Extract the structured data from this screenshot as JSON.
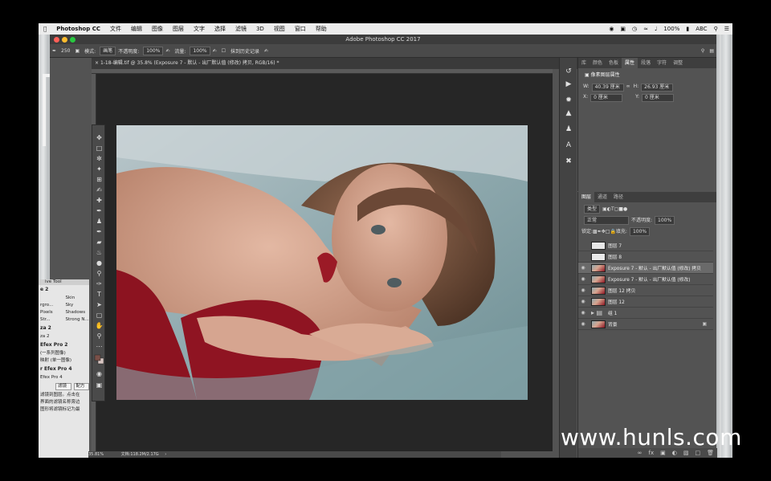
{
  "menubar": {
    "app_name": "Photoshop CC",
    "items": [
      "文件",
      "编辑",
      "图像",
      "图层",
      "文字",
      "选择",
      "滤镜",
      "3D",
      "视图",
      "窗口",
      "帮助"
    ],
    "battery": "100%",
    "input_method": "ABC"
  },
  "window": {
    "title": "Adobe Photoshop CC 2017"
  },
  "options_bar": {
    "brush_size": "250",
    "mode_label": "模式:",
    "mode_value": "画笔",
    "opacity_label": "不透明度:",
    "opacity_value": "100%",
    "flow_label": "流量:",
    "flow_value": "100%",
    "history_label": "抹到历史记录"
  },
  "document": {
    "tab_title": "1-18-编辑.tif @ 35.8% (Exposure 7 - 默认 - 出厂默认值 (修改) 拷贝, RGB/16) *",
    "zoom": "35.81%",
    "doc_size": "文档:118.2M/2.17G"
  },
  "plugin_panel": {
    "title": "ive Tool",
    "section1": "e 2",
    "grid1": [
      [
        "Skin"
      ],
      [
        "rgro...",
        "Sky"
      ],
      [
        "Pixels",
        "Shadows"
      ],
      [
        "Str...",
        "Strong N..."
      ]
    ],
    "section2": "za 2",
    "section2b": "za 2",
    "section3": "Efex Pro 2",
    "items3": [
      "(一系列图像)",
      "映射 (单一图像)"
    ],
    "section4": "r Efex Pro 4",
    "item4": "Efex Pro 4",
    "btn_filter": "滤镜",
    "btn_preset": "配方",
    "desc": [
      "滤镜到图层。点击在",
      "界面的滤镜名称旁边",
      "图形将滤镜标记为最"
    ]
  },
  "properties_panel": {
    "tabs": [
      "库",
      "颜色",
      "色板",
      "属性",
      "段落",
      "字符",
      "调整"
    ],
    "active_tab": "属性",
    "title": "像素图层属性",
    "w_label": "W:",
    "w_value": "40.39 厘米",
    "h_label": "H:",
    "h_value": "26.93 厘米",
    "x_label": "X:",
    "x_value": "0 厘米",
    "y_label": "Y:",
    "y_value": "0 厘米"
  },
  "layers_panel": {
    "tabs": [
      "图层",
      "通道",
      "路径"
    ],
    "active_tab": "图层",
    "filter_label": "类型",
    "blend_mode": "正常",
    "opacity_label": "不透明度:",
    "opacity_value": "100%",
    "lock_label": "锁定:",
    "fill_label": "填充:",
    "fill_value": "100%",
    "layers": [
      {
        "name": "图层 7",
        "visible": false,
        "selected": false
      },
      {
        "name": "图层 8",
        "visible": false,
        "selected": false
      },
      {
        "name": "Exposure 7 - 默认 - 出厂默认值 (修改) 拷贝",
        "visible": true,
        "selected": true
      },
      {
        "name": "Exposure 7 - 默认 - 出厂默认值 (修改)",
        "visible": true,
        "selected": false
      },
      {
        "name": "图层 12 拷贝",
        "visible": true,
        "selected": false
      },
      {
        "name": "图层 12",
        "visible": true,
        "selected": false
      },
      {
        "name": "组 1",
        "visible": true,
        "selected": false
      },
      {
        "name": "背景",
        "visible": true,
        "selected": false
      }
    ]
  },
  "watermark": "www.hunls.com"
}
